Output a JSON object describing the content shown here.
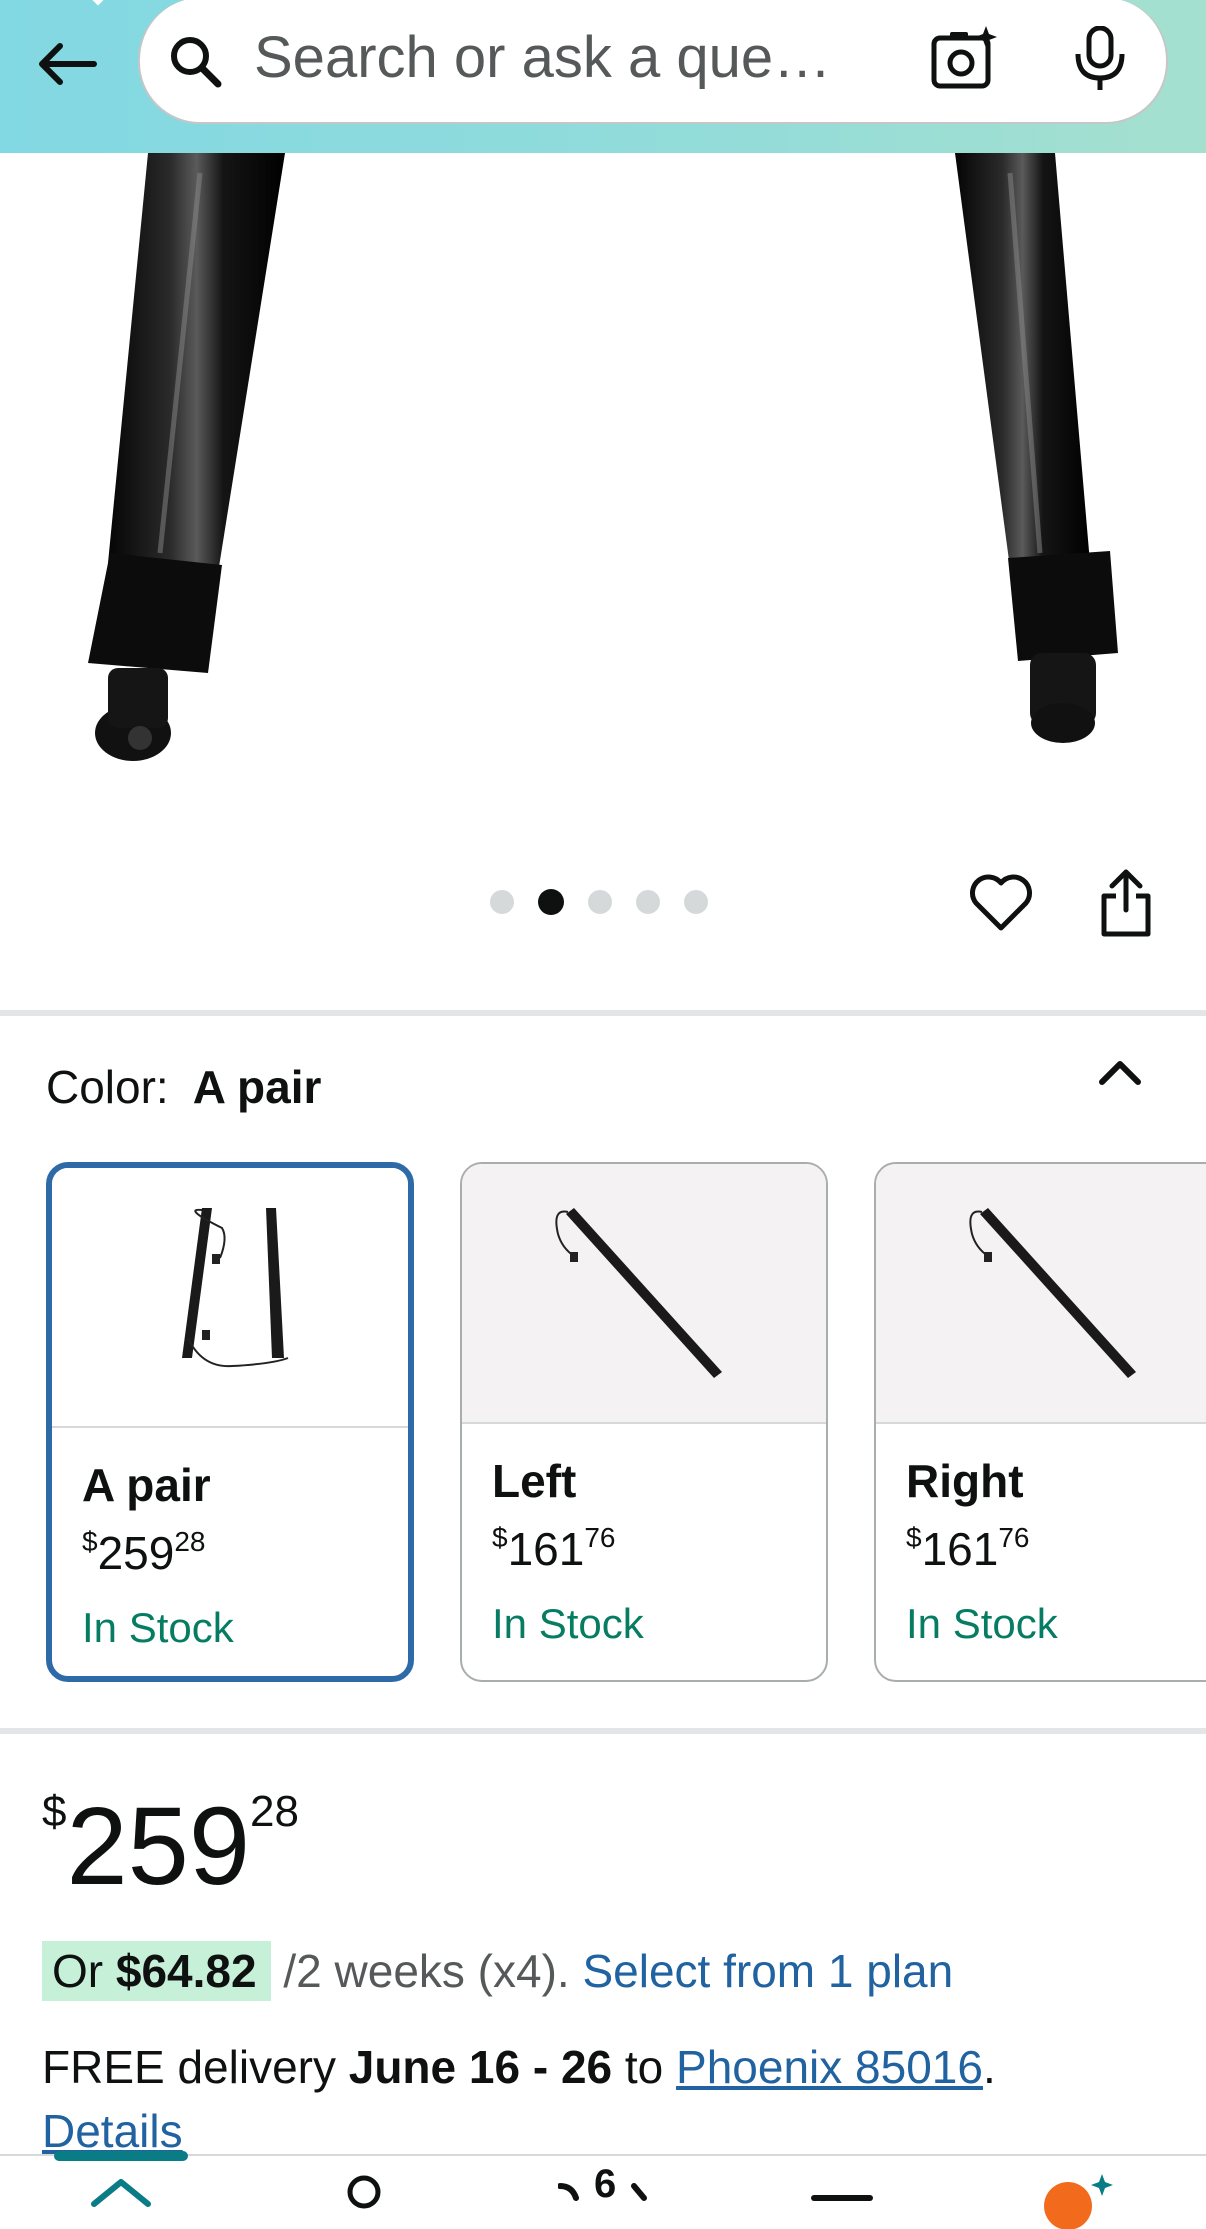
{
  "header": {
    "search_placeholder": "Search or ask a que…",
    "icons": [
      "back-arrow-icon",
      "search-icon",
      "camera-lens-icon",
      "microphone-icon"
    ]
  },
  "gallery": {
    "image_count": 5,
    "active_index": 1
  },
  "color_selector": {
    "label": "Color:",
    "selected_value": "A pair",
    "variants": [
      {
        "name": "A pair",
        "price_symbol": "$",
        "price_whole": "259",
        "price_cents": "28",
        "availability": "In Stock",
        "selected": true
      },
      {
        "name": "Left",
        "price_symbol": "$",
        "price_whole": "161",
        "price_cents": "76",
        "availability": "In Stock",
        "selected": false
      },
      {
        "name": "Right",
        "price_symbol": "$",
        "price_whole": "161",
        "price_cents": "76",
        "availability": "In Stock",
        "selected": false
      }
    ]
  },
  "price": {
    "symbol": "$",
    "whole": "259",
    "cents": "28"
  },
  "installment": {
    "prefix": "Or ",
    "amount": "$64.82",
    "terms": " /2 weeks (x4). ",
    "link": "Select from 1 plan"
  },
  "delivery": {
    "prefix": "FREE delivery ",
    "dates": "June 16 - 26",
    "to": " to ",
    "location": "Phoenix 85016",
    "suffix": ".",
    "details_link": "Details"
  },
  "bottom_nav": {
    "cart_count": "6",
    "items": [
      "home-icon",
      "account-icon",
      "cart-icon",
      "menu-icon",
      "rufus-icon"
    ]
  },
  "colors": {
    "header_gradient_start": "#82d8e3",
    "header_gradient_end": "#a5e0cf",
    "selected_border": "#2f6aa8",
    "in_stock": "#067d62",
    "link": "#2162a1",
    "installment_chip": "#c7f0d9",
    "nav_indicator": "#0a7c86",
    "rufus_orange": "#f26b1d"
  }
}
